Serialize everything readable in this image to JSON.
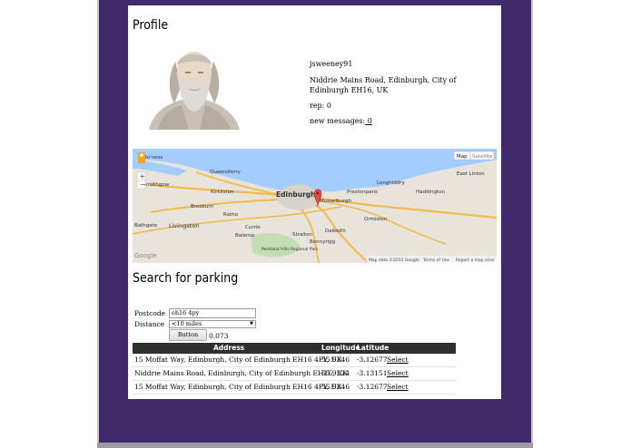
{
  "profile": {
    "title": "Profile",
    "username": "jsweeney91",
    "address": "Niddrie Mains Road, Edinburgh, City of Edinburgh EH16, UK",
    "rep_label": "rep: 0",
    "messages_label": "new messages:",
    "messages_count": " 0"
  },
  "map": {
    "map_tab": "Map",
    "satellite_tab": "Satellite",
    "attribution": "Map data ©2015 Google",
    "terms": "Terms of Use",
    "report": "Report a map error",
    "places": [
      "Bo'ness",
      "Queensferry",
      "Linlithgow",
      "Kirkliston",
      "Edinburgh",
      "Musselburgh",
      "Prestonpans",
      "Longniddry",
      "Haddington",
      "East Linton",
      "Broxburn",
      "Ratho",
      "Bathgate",
      "Livingston",
      "Currie",
      "Balerno",
      "Dalkeith",
      "Ormiston",
      "Straiton",
      "Bonnyrigg",
      "Pentland Hills Regional Park",
      "Google"
    ]
  },
  "search": {
    "title": "Search for parking",
    "postcode_label": "Postcode",
    "postcode_value": "eh16 4py",
    "distance_label": "Distance",
    "distance_value": "<10 miles",
    "button_label": "Button",
    "result_value": "0.073"
  },
  "results": {
    "headers": [
      "Address",
      "Longitude",
      "Latitude"
    ],
    "rows": [
      {
        "address": "15 Moffat Way, Edinburgh, City of Edinburgh EH16 4PY, UK",
        "longitude": "55.9346",
        "latitude": "-3.12677",
        "action": "Select"
      },
      {
        "address": "Niddrie Mains Road, Edinburgh, City of Edinburgh EH16, UK",
        "longitude": "55.9324",
        "latitude": "-3.13151",
        "action": "Select"
      },
      {
        "address": "15 Moffat Way, Edinburgh, City of Edinburgh EH16 4PY, UK",
        "longitude": "55.9346",
        "latitude": "-3.12677",
        "action": "Select"
      }
    ]
  },
  "colors": {
    "frame": "#3f2a6b",
    "table_header": "#2e2e2e",
    "water": "#a3ccff",
    "land": "#e8e4dc",
    "road": "#f2b94b"
  }
}
